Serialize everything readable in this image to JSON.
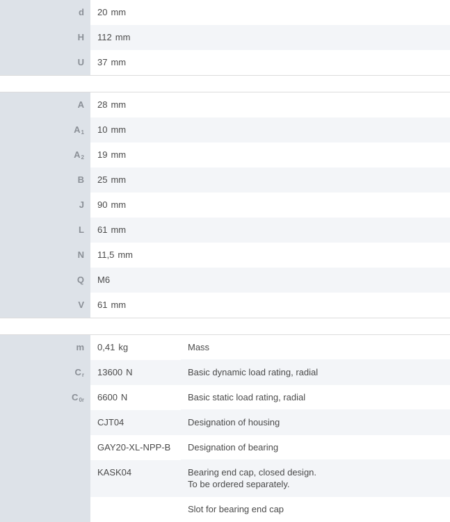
{
  "section1": [
    {
      "key": "d",
      "value": "20",
      "unit": "mm"
    },
    {
      "key": "H",
      "value": "112",
      "unit": "mm"
    },
    {
      "key": "U",
      "value": "37",
      "unit": "mm"
    }
  ],
  "section2": [
    {
      "key": "A",
      "sub": "",
      "value": "28",
      "unit": "mm"
    },
    {
      "key": "A",
      "sub": "1",
      "value": "10",
      "unit": "mm"
    },
    {
      "key": "A",
      "sub": "2",
      "value": "19",
      "unit": "mm"
    },
    {
      "key": "B",
      "sub": "",
      "value": "25",
      "unit": "mm"
    },
    {
      "key": "J",
      "sub": "",
      "value": "90",
      "unit": "mm"
    },
    {
      "key": "L",
      "sub": "",
      "value": "61",
      "unit": "mm"
    },
    {
      "key": "N",
      "sub": "",
      "value": "11,5",
      "unit": "mm"
    },
    {
      "key": "Q",
      "sub": "",
      "value": "M6",
      "unit": ""
    },
    {
      "key": "V",
      "sub": "",
      "value": "61",
      "unit": "mm"
    }
  ],
  "section3": [
    {
      "key": "m",
      "sub": "",
      "value": "0,41",
      "unit": "kg",
      "desc": "Mass",
      "desc2": ""
    },
    {
      "key": "C",
      "sub": "r",
      "value": "13600",
      "unit": "N",
      "desc": "Basic dynamic load rating, radial",
      "desc2": ""
    },
    {
      "key": "C",
      "sub": "0r",
      "value": "6600",
      "unit": "N",
      "desc": "Basic static load rating, radial",
      "desc2": ""
    },
    {
      "key": "",
      "sub": "",
      "value": "CJT04",
      "unit": "",
      "desc": "Designation of housing",
      "desc2": ""
    },
    {
      "key": "",
      "sub": "",
      "value": "GAY20-XL-NPP-B",
      "unit": "",
      "desc": "Designation of bearing",
      "desc2": ""
    },
    {
      "key": "",
      "sub": "",
      "value": "KASK04",
      "unit": "",
      "desc": "Bearing end cap, closed design.",
      "desc2": "To be ordered separately."
    },
    {
      "key": "",
      "sub": "",
      "value": "",
      "unit": "",
      "desc": "Slot for bearing end cap",
      "desc2": ""
    }
  ]
}
